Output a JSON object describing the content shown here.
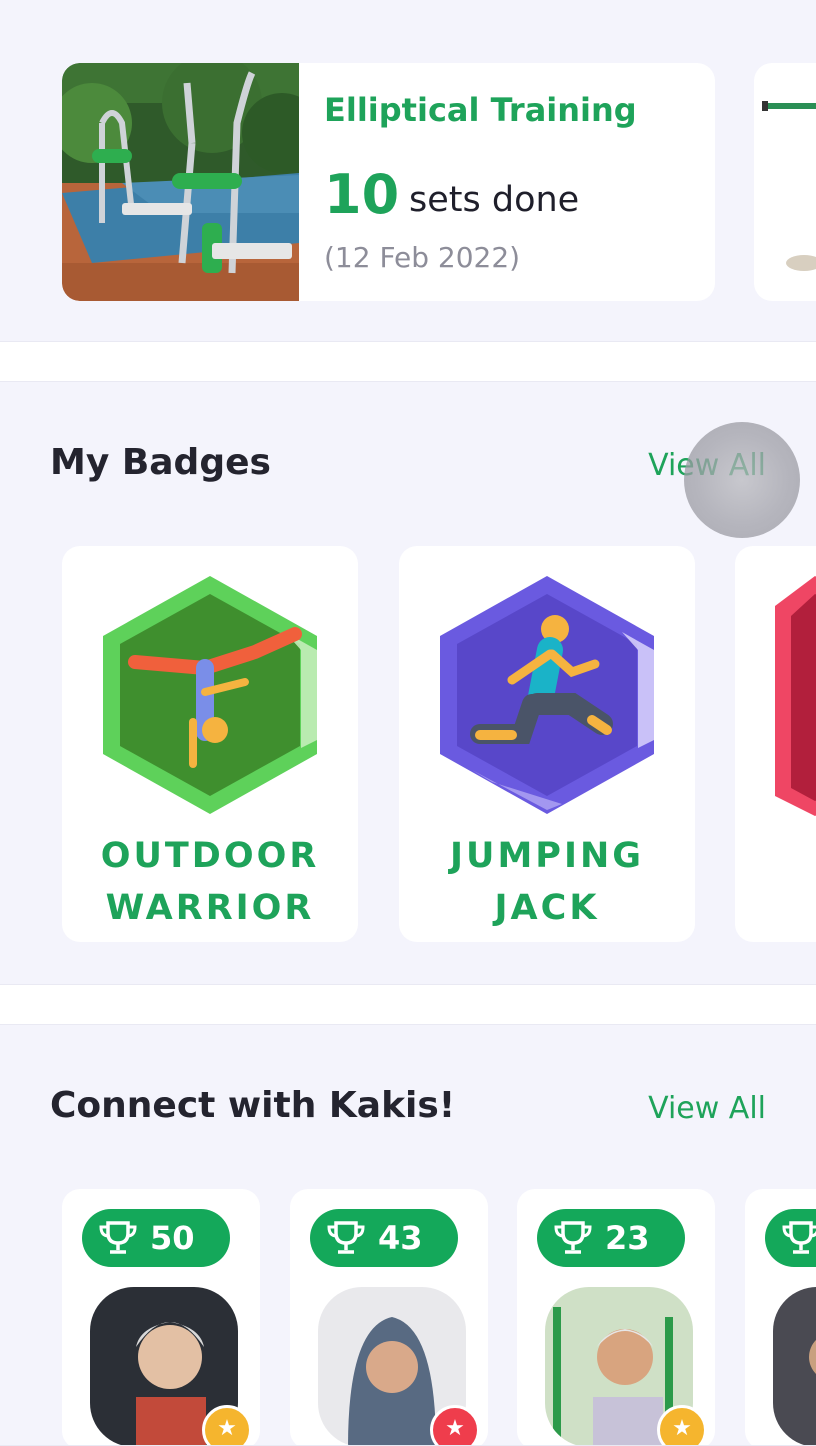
{
  "activity": {
    "title": "Elliptical Training",
    "count": "10",
    "unit": "sets done",
    "date": "(12 Feb 2022)"
  },
  "badges": {
    "heading": "My Badges",
    "view_all": "View All",
    "items": [
      {
        "line1": "OUTDOOR",
        "line2": "WARRIOR",
        "icon": "handstand-icon",
        "color": "#5ed15a"
      },
      {
        "line1": "JUMPING",
        "line2": "JACK",
        "icon": "runner-icon",
        "color": "#6a5ae0"
      },
      {
        "icon": "badge-icon",
        "color": "#ef4664"
      }
    ]
  },
  "kakis": {
    "heading": "Connect with Kakis!",
    "view_all": "View All",
    "items": [
      {
        "points": "50",
        "star_color": "#f5b52e"
      },
      {
        "points": "43",
        "star_color": "#ef3d4c"
      },
      {
        "points": "23",
        "star_color": "#f5b52e"
      },
      {
        "points": "",
        "star_color": "#f5b52e"
      }
    ]
  },
  "colors": {
    "accent": "#1ea35a",
    "pill": "#14a85a",
    "section_bg": "#f4f4fc"
  }
}
